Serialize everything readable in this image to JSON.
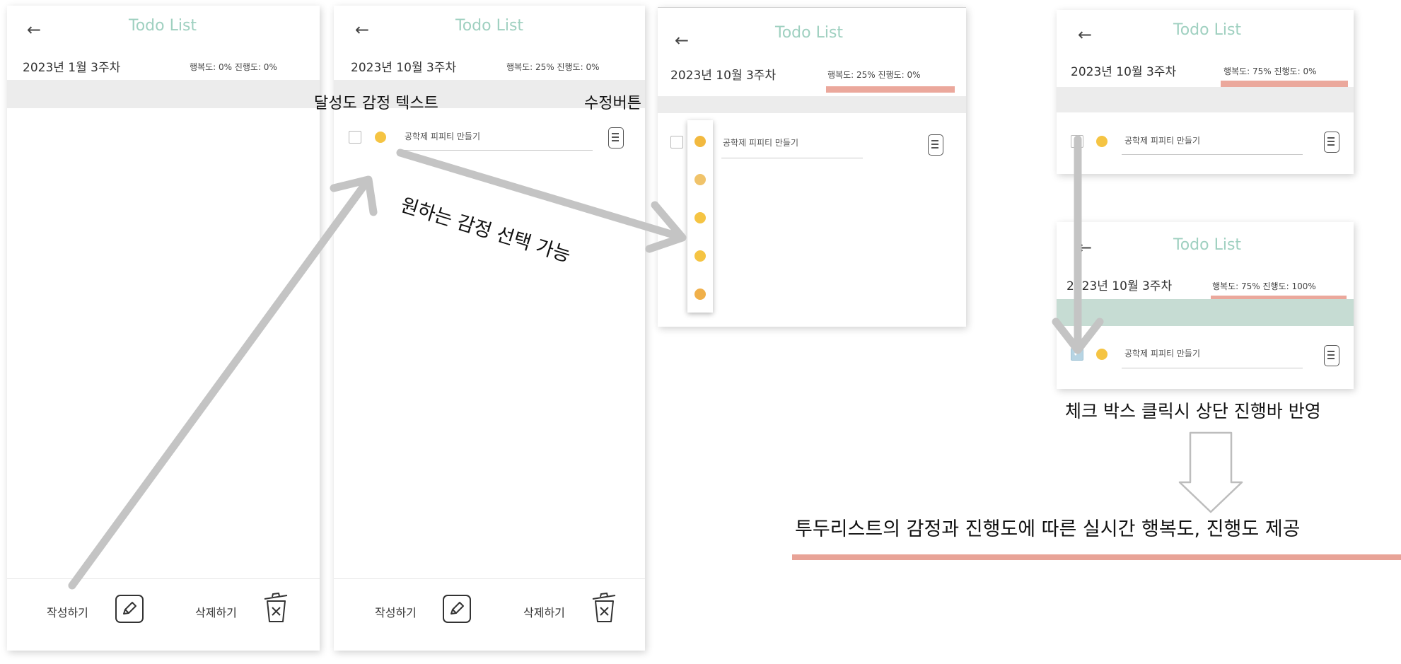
{
  "screen1": {
    "back": "←",
    "title": "Todo List",
    "week": "2023년 1월 3주차",
    "stats": "행복도: 0%  진행도: 0%",
    "write_label": "작성하기",
    "delete_label": "삭제하기"
  },
  "screen2": {
    "back": "←",
    "title": "Todo List",
    "week": "2023년 10월 3주차",
    "stats": "행복도: 25%  진행도: 0%",
    "task": "공학제 피피티 만들기",
    "write_label": "작성하기",
    "delete_label": "삭제하기"
  },
  "screen3": {
    "back": "←",
    "title": "Todo List",
    "week": "2023년 10월 3주차",
    "stats": "행복도: 25%  진행도: 0%",
    "task": "공학제 피피티 만들기",
    "emotion_options": [
      "crying",
      "sad",
      "neutral",
      "happy",
      "very-happy"
    ]
  },
  "screen4": {
    "back": "←",
    "title": "Todo List",
    "week": "2023년 10월 3주차",
    "stats": "행복도: 75%  진행도: 0%",
    "task": "공학제 피피티 만들기"
  },
  "screen5": {
    "back": "←",
    "title": "Todo List",
    "week": "2023년 10월 3주차",
    "stats": "행복도: 75%  진행도: 100%",
    "task": "공학제 피피티 만들기",
    "checked": true
  },
  "annotations": {
    "header_left": "달성도 감정 텍스트",
    "header_right": "수정버튼",
    "emotion_select": "원하는 감정 선택 가능",
    "checkbox_note": "체크 박스 클릭시 상단 진행바 반영",
    "summary": "투두리스트의 감정과 진행도에 따른 실시간 행복도, 진행도 제공"
  },
  "colors": {
    "title": "#9fd0c0",
    "highlight": "#eba89c",
    "progress_bar": "#c6dcd3",
    "emoji": "#f5c443"
  }
}
